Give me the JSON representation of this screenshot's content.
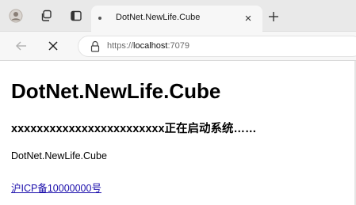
{
  "browser": {
    "tab": {
      "title": "DotNet.NewLife.Cube",
      "close_glyph": "×"
    },
    "icons": {
      "profile": "profile-icon",
      "workspaces": "workspaces-icon",
      "tab_actions": "tab-actions-icon",
      "new_tab": "plus-icon",
      "back": "back-arrow-icon",
      "close": "close-icon",
      "site_info": "lock-icon"
    },
    "address": {
      "scheme": "https://",
      "host": "localhost",
      "port": ":7079"
    }
  },
  "page": {
    "title": "DotNet.NewLife.Cube",
    "status": "xxxxxxxxxxxxxxxxxxxxxxxx正在启动系统……",
    "app_name": "DotNet.NewLife.Cube",
    "icp_link": "沪ICP备10000000号"
  },
  "colors": {
    "link": "#1a0dab",
    "tabstrip_bg": "#e9e9e9",
    "toolbar_bg": "#f7f7f7"
  }
}
